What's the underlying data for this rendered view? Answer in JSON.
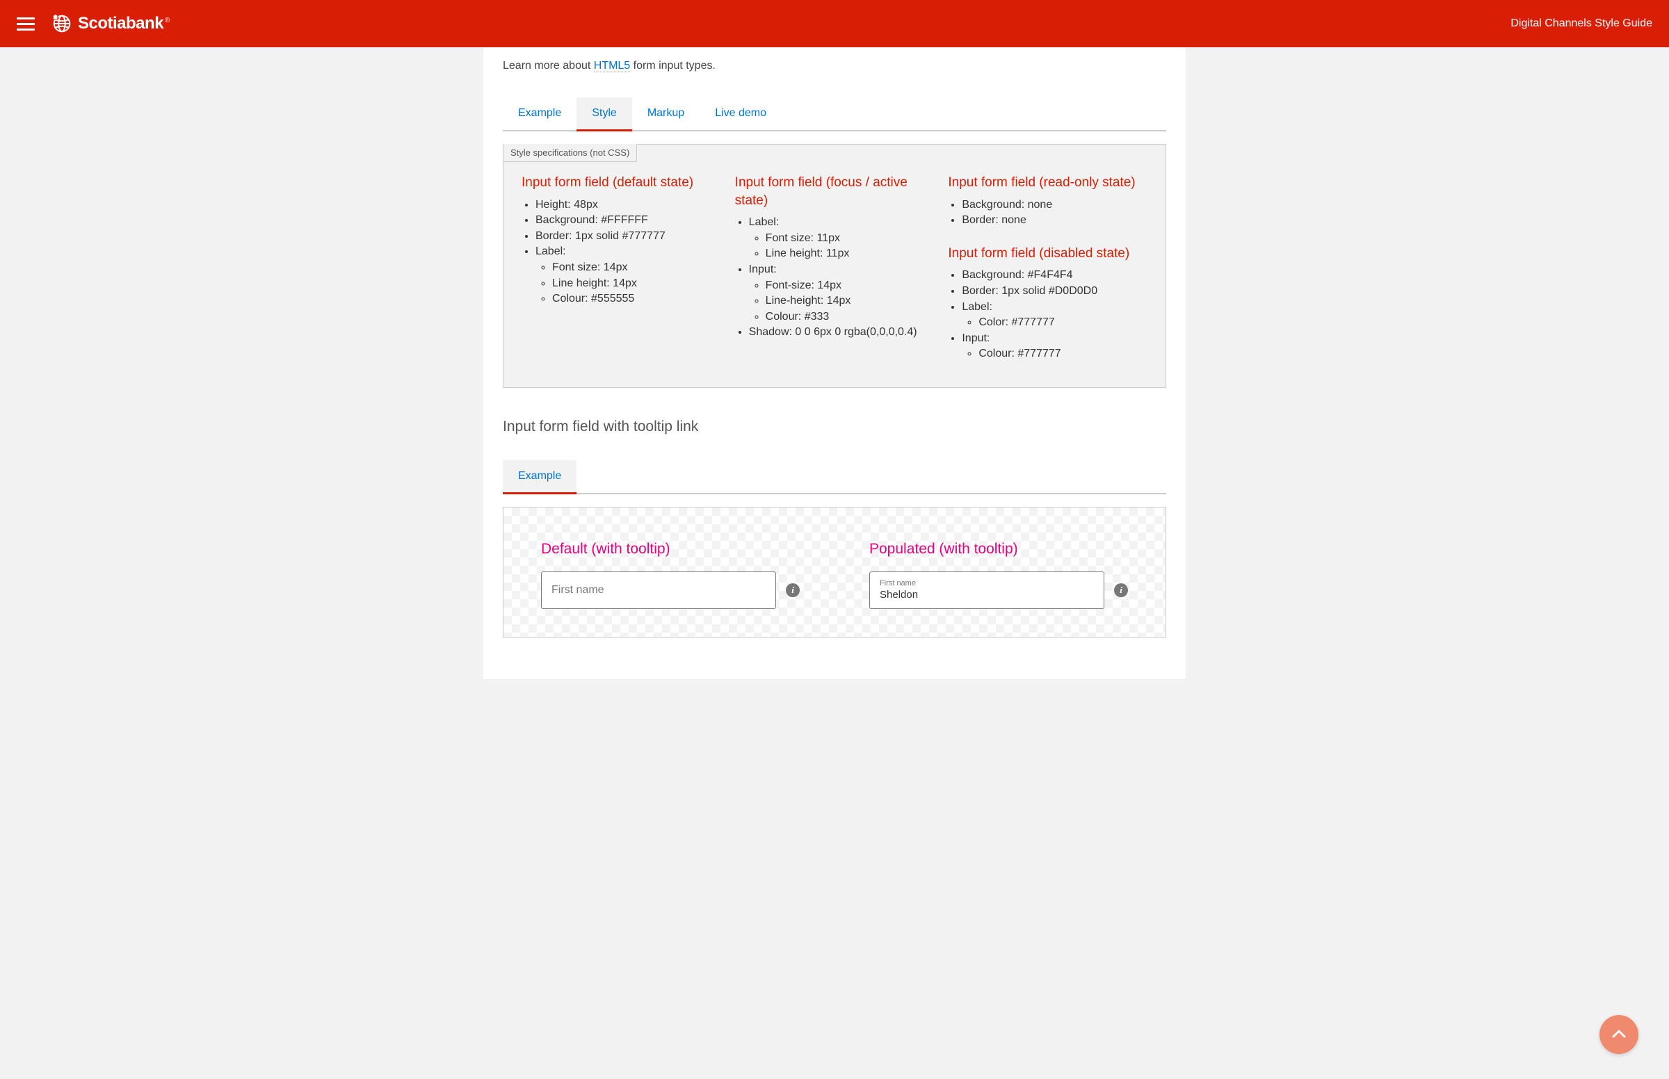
{
  "header": {
    "brand": "Scotiabank",
    "tagline": "Digital Channels Style Guide"
  },
  "lead": {
    "prefix": "Learn more about ",
    "link": "HTML5",
    "suffix": " form input types."
  },
  "tabs1": {
    "items": [
      "Example",
      "Style",
      "Markup",
      "Live demo"
    ],
    "activeIndex": 1
  },
  "spec": {
    "tag": "Style specifications (not CSS)",
    "col1": {
      "heading": "Input form field (default state)",
      "items": [
        "Height: 48px",
        "Background: #FFFFFF",
        "Border: 1px solid #777777",
        "Label:"
      ],
      "labelSub": [
        "Font size: 14px",
        "Line height: 14px",
        "Colour: #555555"
      ]
    },
    "col2": {
      "heading": "Input form field (focus / active state)",
      "labelItem": "Label:",
      "labelSub": [
        "Font size: 11px",
        "Line height: 11px"
      ],
      "inputItem": "Input:",
      "inputSub": [
        "Font-size: 14px",
        "Line-height: 14px",
        "Colour: #333"
      ],
      "shadow": "Shadow: 0 0 6px 0 rgba(0,0,0,0.4)"
    },
    "col3a": {
      "heading": "Input form field (read-only state)",
      "items": [
        "Background: none",
        "Border: none"
      ]
    },
    "col3b": {
      "heading": "Input form field (disabled state)",
      "items": [
        "Background: #F4F4F4",
        "Border: 1px solid #D0D0D0"
      ],
      "labelItem": "Label:",
      "labelSub": [
        "Color: #777777"
      ],
      "inputItem": "Input:",
      "inputSub": [
        "Colour: #777777"
      ]
    }
  },
  "section2": {
    "title": "Input form field with tooltip link"
  },
  "tabs2": {
    "items": [
      "Example"
    ],
    "activeIndex": 0
  },
  "example": {
    "col1": {
      "label": "Default (with tooltip)",
      "placeholder": "First name"
    },
    "col2": {
      "label": "Populated (with tooltip)",
      "smallLabel": "First name",
      "value": "Sheldon"
    }
  }
}
